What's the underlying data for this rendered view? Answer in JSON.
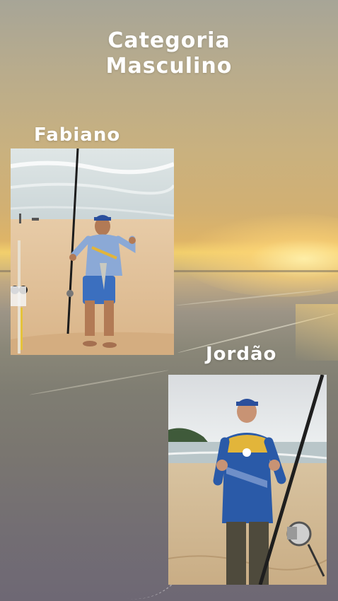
{
  "story": {
    "title_line1": "Categoria",
    "title_line2": "Masculino"
  },
  "athletes": [
    {
      "name": "Fabiano",
      "photo_icon": "angler-with-surf-rod-photo"
    },
    {
      "name": "Jordão",
      "photo_icon": "angler-with-rod-and-reel-photo"
    }
  ],
  "colors": {
    "title_text": "#ffffff",
    "sky_glow": "#f2cf6c",
    "jersey_blue": "#2a5aa8",
    "jersey_yellow": "#e2b53a"
  }
}
